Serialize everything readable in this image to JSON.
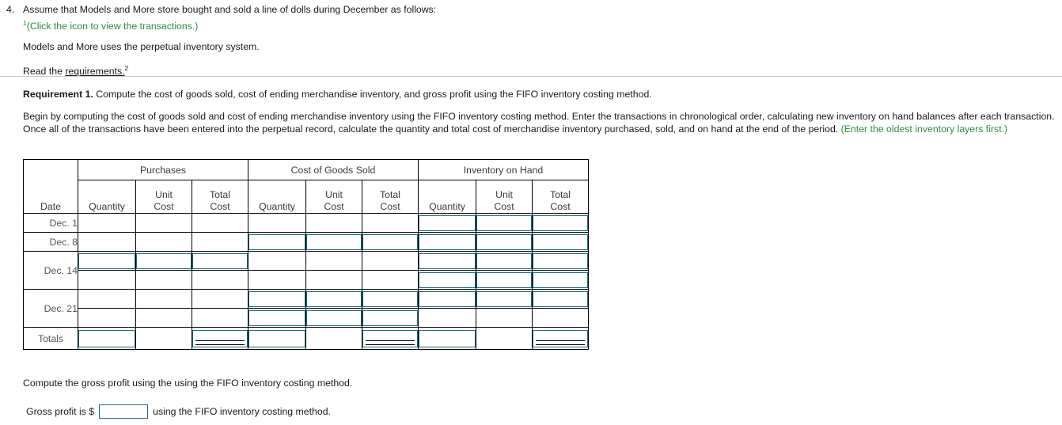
{
  "question": {
    "number": "4.",
    "line1": "Assume that Models and More store bought and sold a line of dolls during December as follows:",
    "click_icon_sup": "1",
    "click_icon_text": "(Click the icon to view the transactions.)",
    "line3": "Models and More uses the perpetual inventory system.",
    "read_prefix": "Read the ",
    "read_link": "requirements.",
    "read_sup": "2"
  },
  "requirement": {
    "label": "Requirement 1.",
    "head_rest": " Compute the cost of goods sold, cost of ending merchandise inventory, and gross profit using the FIFO inventory costing method.",
    "para_black": "Begin by computing the cost of goods sold and cost of ending merchandise inventory using the FIFO inventory costing method. Enter the transactions in chronological order, calculating new inventory on hand balances after each transaction. Once all of the transactions have been entered into the perpetual record, calculate the quantity and total cost of merchandise inventory purchased, sold, and on hand at the end of the period. ",
    "para_green": "(Enter the oldest inventory layers first.)"
  },
  "table": {
    "group_headers": [
      "",
      "Purchases",
      "Cost of Goods Sold",
      "Inventory on Hand"
    ],
    "sub_headers": {
      "date": "Date",
      "quantity": "Quantity",
      "unit_cost_l1": "Unit",
      "unit_cost_l2": "Cost",
      "total_cost_l1": "Total",
      "total_cost_l2": "Cost"
    },
    "rows": [
      {
        "date": "Dec. 1",
        "purchases": [
          "",
          "",
          ""
        ],
        "cogs": [
          "",
          "",
          ""
        ],
        "onhand": [
          "input",
          "input",
          "input"
        ]
      },
      {
        "date": "Dec. 8",
        "purchases": [
          "",
          "",
          ""
        ],
        "cogs": [
          "input",
          "input",
          "input"
        ],
        "onhand": [
          "input",
          "input",
          "input"
        ]
      },
      {
        "date": "Dec. 14",
        "purchases": [
          "input",
          "input",
          "input"
        ],
        "cogs": [
          "",
          "",
          ""
        ],
        "onhand": [
          "input",
          "input",
          "input"
        ]
      },
      {
        "date": "",
        "purchases": [
          "",
          "",
          ""
        ],
        "cogs": [
          "",
          "",
          ""
        ],
        "onhand": [
          "input",
          "input",
          "input"
        ]
      },
      {
        "date": "Dec. 21",
        "purchases": [
          "",
          "",
          ""
        ],
        "cogs": [
          "input",
          "input",
          "input"
        ],
        "onhand": [
          "input",
          "input",
          "input"
        ]
      },
      {
        "date": "",
        "purchases": [
          "",
          "",
          ""
        ],
        "cogs": [
          "input",
          "input",
          "input"
        ],
        "onhand": [
          "",
          "",
          ""
        ]
      }
    ],
    "totals": {
      "label": "Totals",
      "purchases": [
        "input",
        "",
        "input-double"
      ],
      "cogs": [
        "input",
        "",
        "input-double"
      ],
      "onhand": [
        "input",
        "",
        "input-double"
      ]
    }
  },
  "bottom": {
    "compute_line": "Compute the gross profit using the using the FIFO inventory costing method.",
    "gross_prefix": "Gross profit is $",
    "gross_value": "",
    "gross_suffix": "using the FIFO inventory costing method."
  },
  "colors": {
    "green": "#2e8b3f",
    "field_border": "#1f6b7d",
    "text": "#1a1a1a",
    "rule": "#c9c9c9"
  }
}
